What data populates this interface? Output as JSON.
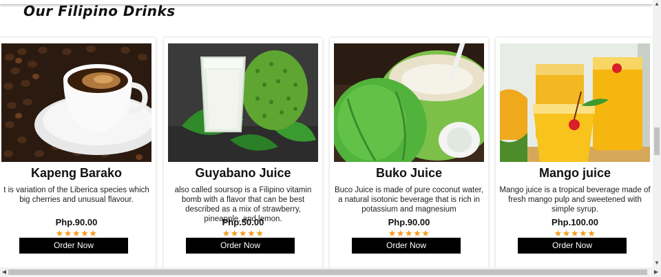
{
  "section": {
    "title": "Our Filipino Drinks"
  },
  "colors": {
    "button_bg": "#000000",
    "star": "#f29b1c"
  },
  "products": [
    {
      "name": "Kapeng Barako",
      "description": "t is variation of the Liberica species which big cherries and unusual flavour.",
      "price": "Php.90.00",
      "stars": "★★★★★",
      "button": "Order Now",
      "image_icon": "coffee-cup-image"
    },
    {
      "name": "Guyabano Juice",
      "description": "also called soursop is a Filipino vitamin bomb with a flavor that can be best described as a mix of strawberry, pineapple, and lemon.",
      "price": "Php.50.00",
      "stars": "★★★★★",
      "button": "Order Now",
      "image_icon": "soursop-juice-image"
    },
    {
      "name": "Buko Juice",
      "description": "Buco Juice is made of pure coconut water, a natural isotonic beverage that is rich in potassium and magnesium",
      "price": "Php.90.00",
      "stars": "★★★★★",
      "button": "Order Now",
      "image_icon": "coconut-image"
    },
    {
      "name": "Mango juice",
      "description": "Mango juice is a tropical beverage made of fresh mango pulp and sweetened with simple syrup.",
      "price": "Php.100.00",
      "stars": "★★★★★",
      "button": "Order Now",
      "image_icon": "mango-juice-image"
    }
  ]
}
